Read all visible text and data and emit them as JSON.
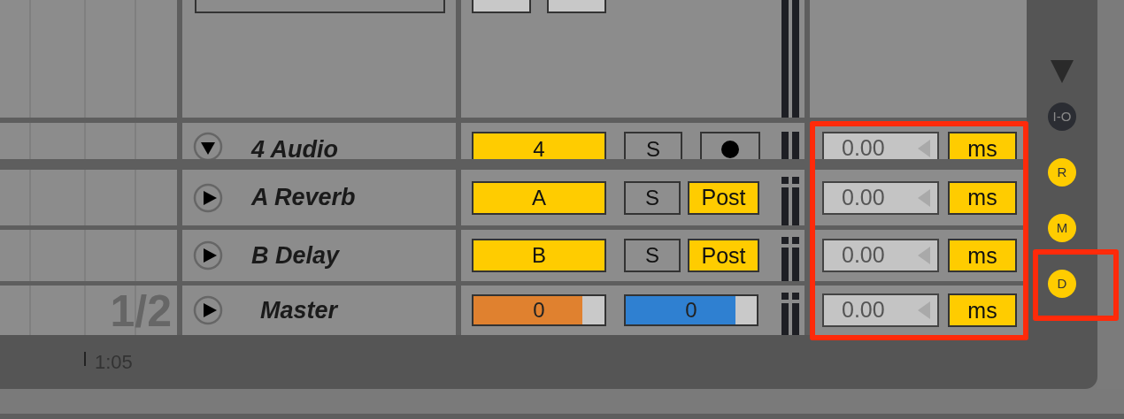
{
  "tracks": [
    {
      "kind": "audio",
      "name": "4 Audio",
      "expanded": true,
      "label": "4",
      "solo": "S",
      "solo_on": false,
      "delay": "0.00",
      "unit": "ms"
    },
    {
      "kind": "return",
      "name": "A Reverb",
      "expanded": false,
      "label": "A",
      "solo": "S",
      "solo_on": false,
      "send_mode": "Post",
      "delay": "0.00",
      "unit": "ms"
    },
    {
      "kind": "return",
      "name": "B Delay",
      "expanded": false,
      "label": "B",
      "solo": "S",
      "solo_on": false,
      "send_mode": "Post",
      "delay": "0.00",
      "unit": "ms"
    },
    {
      "kind": "master",
      "name": "Master",
      "expanded": false,
      "sliders": [
        {
          "value": "0",
          "level": 0.83,
          "color": "#e0812f"
        },
        {
          "value": "0",
          "level": 0.84,
          "color": "#2f80d1"
        }
      ],
      "delay": "0.00",
      "unit": "ms"
    }
  ],
  "arrangement": {
    "position": "1/2",
    "time": "1:05"
  },
  "section_toggles": [
    {
      "label": "I-O",
      "on": false
    },
    {
      "label": "R",
      "on": true
    },
    {
      "label": "M",
      "on": true
    },
    {
      "label": "D",
      "on": true
    }
  ]
}
